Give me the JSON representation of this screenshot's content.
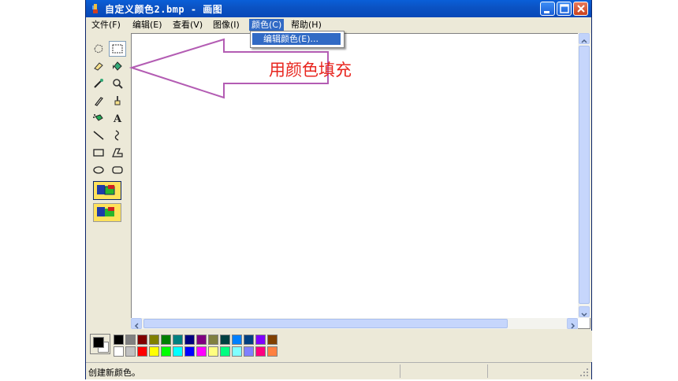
{
  "window": {
    "title": "自定义颜色2.bmp - 画图"
  },
  "titlebar_buttons": {
    "minimize": "minimize-icon",
    "maximize": "maximize-icon",
    "close": "close-icon"
  },
  "menu": {
    "items": [
      {
        "label": "文件(F)"
      },
      {
        "label": "编辑(E)"
      },
      {
        "label": "查看(V)"
      },
      {
        "label": "图像(I)"
      },
      {
        "label": "颜色(C)"
      },
      {
        "label": "帮助(H)"
      }
    ],
    "active_index": 4,
    "dropdown_items": [
      {
        "label": "编辑颜色(E)..."
      }
    ]
  },
  "annotation": {
    "text": "用颜色填充",
    "arrow_color": "#b35cb3",
    "text_color": "#e8261f"
  },
  "tools": [
    "free-select-icon",
    "rect-select-icon",
    "eraser-icon",
    "fill-bucket-icon",
    "color-picker-icon",
    "magnifier-icon",
    "pencil-icon",
    "brush-icon",
    "airbrush-icon",
    "text-icon",
    "line-icon",
    "curve-icon",
    "rectangle-icon",
    "polygon-icon",
    "ellipse-icon",
    "rounded-rect-icon"
  ],
  "palette": {
    "foreground": "#000000",
    "background": "#ffffff",
    "top_row": [
      "#000000",
      "#808080",
      "#800000",
      "#808000",
      "#008000",
      "#008080",
      "#000080",
      "#800080",
      "#808040",
      "#004040",
      "#0080ff",
      "#004080",
      "#8000ff",
      "#804000"
    ],
    "bottom_row": [
      "#ffffff",
      "#c0c0c0",
      "#ff0000",
      "#ffff00",
      "#00ff00",
      "#00ffff",
      "#0000ff",
      "#ff00ff",
      "#ffff80",
      "#00ff80",
      "#80ffff",
      "#8080ff",
      "#ff0080",
      "#ff8040"
    ]
  },
  "status": {
    "text": "创建新颜色。"
  }
}
